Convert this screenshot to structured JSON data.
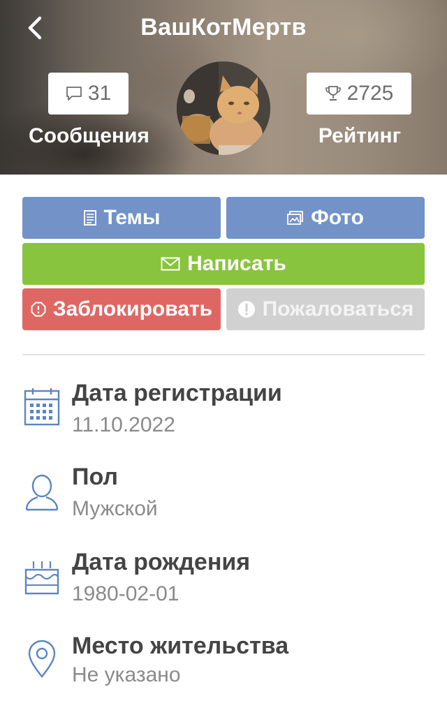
{
  "header": {
    "title": "ВашКотМертв",
    "messages": {
      "count": "31",
      "label": "Сообщения"
    },
    "rating": {
      "count": "2725",
      "label": "Рейтинг"
    }
  },
  "actions": {
    "topics_label": "Темы",
    "photo_label": "Фото",
    "write_label": "Написать",
    "block_label": "Заблокировать",
    "report_label": "Пожаловаться"
  },
  "profile_info": [
    {
      "icon": "calendar-icon",
      "label": "Дата регистрации",
      "value": "11.10.2022"
    },
    {
      "icon": "user-icon",
      "label": "Пол",
      "value": "Мужской"
    },
    {
      "icon": "cake-icon",
      "label": "Дата рождения",
      "value": "1980-02-01"
    },
    {
      "icon": "location-pin-icon",
      "label": "Место жительства",
      "value": "Не указано"
    }
  ],
  "colors": {
    "primary_button": "#7292c8",
    "write_button": "#88c43d",
    "block_button": "#df6763",
    "report_button": "#d1d1d1",
    "icon_blue": "#5b84c4"
  }
}
